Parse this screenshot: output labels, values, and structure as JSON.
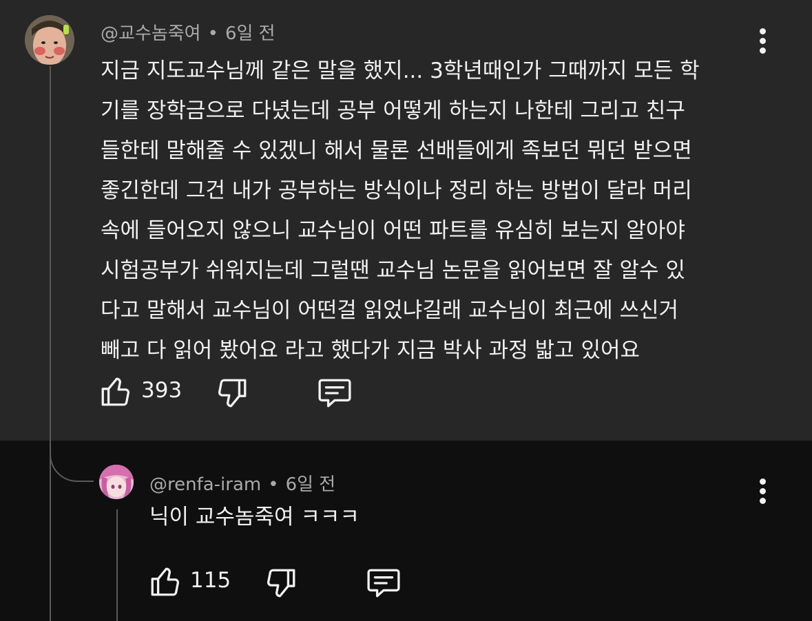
{
  "comment": {
    "author": "@교수놈죽여",
    "separator": "•",
    "time": "6일 전",
    "lines": [
      "지금 지도교수님께 같은 말을 했지... 3학년때인가 그때까지 모든 학",
      "기를 장학금으로 다녔는데 공부 어떻게 하는지 나한테 그리고 친구",
      "들한테 말해줄 수 있겠니 해서 물론 선배들에게 족보던 뭐던 받으면",
      "좋긴한데 그건 내가 공부하는 방식이나 정리 하는 방법이 달라 머리",
      "속에 들어오지 않으니 교수님이 어떤 파트를 유심히 보는지 알아야",
      "시험공부가 쉬워지는데 그럴땐 교수님 논문을 읽어보면 잘 알수 있",
      "다고 말해서 교수님이 어떤걸 읽었냐길래 교수님이 최근에 쓰신거",
      "빼고 다 읽어 봤어요 라고 했다가 지금 박사 과정 밟고 있어요"
    ],
    "like_count": "393",
    "icons": {
      "like": "thumbs-up-icon",
      "dislike": "thumbs-down-icon",
      "reply": "comment-icon",
      "more": "more-vertical-icon"
    }
  },
  "reply": {
    "author": "@renfa-iram",
    "separator": "•",
    "time": "6일 전",
    "text": "닉이 교수놈죽여 ㅋㅋㅋ",
    "like_count": "115",
    "icons": {
      "like": "thumbs-up-icon",
      "dislike": "thumbs-down-icon",
      "reply": "comment-icon",
      "more": "more-vertical-icon"
    }
  },
  "colors": {
    "comment_background": "#272727",
    "reply_background": "#0f0f0f",
    "primary_text": "#f1f1f1",
    "secondary_text": "#aaaaaa",
    "thread_line": "#5a5a5a"
  }
}
